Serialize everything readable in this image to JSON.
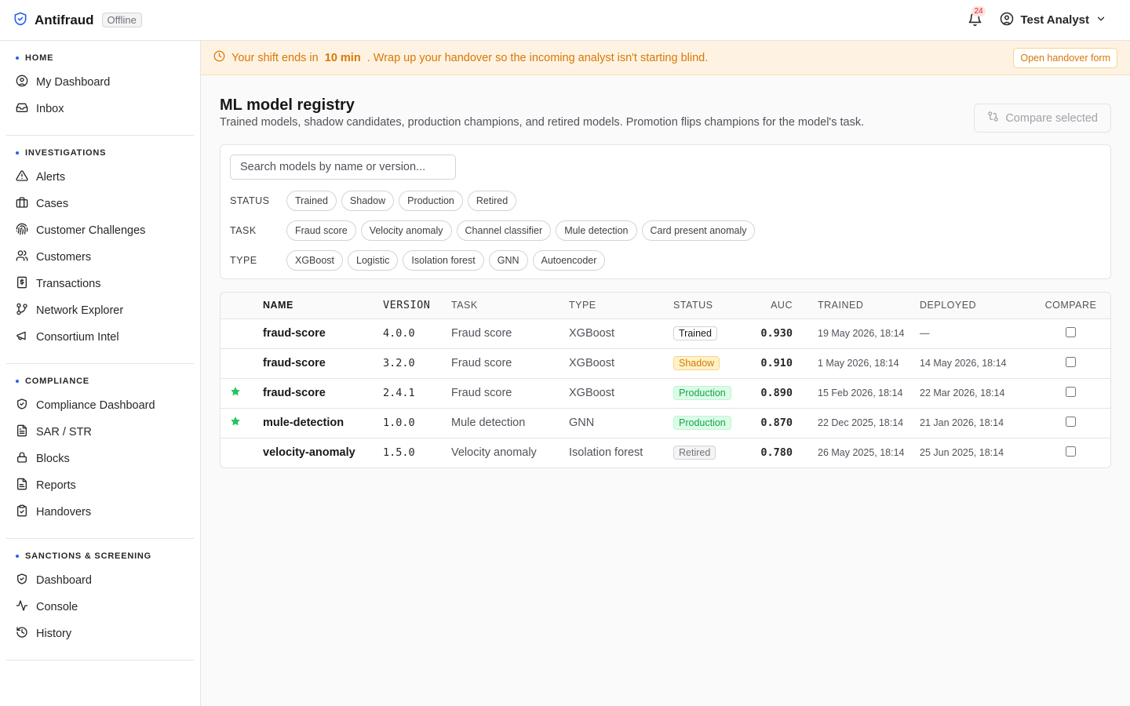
{
  "brand": {
    "name": "Antifraud",
    "status": "Offline"
  },
  "header": {
    "notifications": "24",
    "user": "Test Analyst"
  },
  "sidebar": [
    {
      "heading": "HOME",
      "items": [
        {
          "label": "My Dashboard",
          "icon": "user-circle-icon"
        },
        {
          "label": "Inbox",
          "icon": "inbox-icon"
        }
      ]
    },
    {
      "heading": "INVESTIGATIONS",
      "items": [
        {
          "label": "Alerts",
          "icon": "warning-icon"
        },
        {
          "label": "Cases",
          "icon": "briefcase-icon"
        },
        {
          "label": "Customer Challenges",
          "icon": "fingerprint-icon"
        },
        {
          "label": "Customers",
          "icon": "users-icon"
        },
        {
          "label": "Transactions",
          "icon": "receipt-icon"
        },
        {
          "label": "Network Explorer",
          "icon": "network-icon"
        },
        {
          "label": "Consortium Intel",
          "icon": "megaphone-icon"
        }
      ]
    },
    {
      "heading": "COMPLIANCE",
      "items": [
        {
          "label": "Compliance Dashboard",
          "icon": "shield-check-icon"
        },
        {
          "label": "SAR / STR",
          "icon": "file-text-icon"
        },
        {
          "label": "Blocks",
          "icon": "lock-icon"
        },
        {
          "label": "Reports",
          "icon": "document-icon"
        },
        {
          "label": "Handovers",
          "icon": "clipboard-check-icon"
        }
      ]
    },
    {
      "heading": "SANCTIONS & SCREENING",
      "items": [
        {
          "label": "Dashboard",
          "icon": "shield-check-icon"
        },
        {
          "label": "Console",
          "icon": "activity-icon"
        },
        {
          "label": "History",
          "icon": "history-icon"
        }
      ]
    }
  ],
  "banner": {
    "prefix": "Your shift ends in",
    "time": "10 min",
    "suffix": ". Wrap up your handover so the incoming analyst isn't starting blind.",
    "button": "Open handover form"
  },
  "page": {
    "title": "ML model registry",
    "subtitle": "Trained models, shadow candidates, production champions, and retired models. Promotion flips champions for the model's task.",
    "compare_button": "Compare selected"
  },
  "search": {
    "placeholder": "Search models by name or version..."
  },
  "filters": [
    {
      "label": "STATUS",
      "options": [
        "Trained",
        "Shadow",
        "Production",
        "Retired"
      ]
    },
    {
      "label": "TASK",
      "options": [
        "Fraud score",
        "Velocity anomaly",
        "Channel classifier",
        "Mule detection",
        "Card present anomaly"
      ]
    },
    {
      "label": "TYPE",
      "options": [
        "XGBoost",
        "Logistic",
        "Isolation forest",
        "GNN",
        "Autoencoder"
      ]
    }
  ],
  "table": {
    "columns": [
      "",
      "NAME",
      "VERSION",
      "TASK",
      "TYPE",
      "STATUS",
      "AUC",
      "TRAINED",
      "DEPLOYED",
      "COMPARE"
    ],
    "rows": [
      {
        "champion": false,
        "name": "fraud-score",
        "version": "4.0.0",
        "task": "Fraud score",
        "type": "XGBoost",
        "status": "Trained",
        "auc": "0.930",
        "trained": "19 May 2026, 18:14",
        "deployed": "—"
      },
      {
        "champion": false,
        "name": "fraud-score",
        "version": "3.2.0",
        "task": "Fraud score",
        "type": "XGBoost",
        "status": "Shadow",
        "auc": "0.910",
        "trained": "1 May 2026, 18:14",
        "deployed": "14 May 2026, 18:14"
      },
      {
        "champion": true,
        "name": "fraud-score",
        "version": "2.4.1",
        "task": "Fraud score",
        "type": "XGBoost",
        "status": "Production",
        "auc": "0.890",
        "trained": "15 Feb 2026, 18:14",
        "deployed": "22 Mar 2026, 18:14"
      },
      {
        "champion": true,
        "name": "mule-detection",
        "version": "1.0.0",
        "task": "Mule detection",
        "type": "GNN",
        "status": "Production",
        "auc": "0.870",
        "trained": "22 Dec 2025, 18:14",
        "deployed": "21 Jan 2026, 18:14"
      },
      {
        "champion": false,
        "name": "velocity-anomaly",
        "version": "1.5.0",
        "task": "Velocity anomaly",
        "type": "Isolation forest",
        "status": "Retired",
        "auc": "0.780",
        "trained": "26 May 2025, 18:14",
        "deployed": "25 Jun 2025, 18:14"
      }
    ]
  },
  "colors": {
    "accent": "#2563eb",
    "warning": "#d97706",
    "success": "#16a34a",
    "champion_star": "#22c55e"
  }
}
